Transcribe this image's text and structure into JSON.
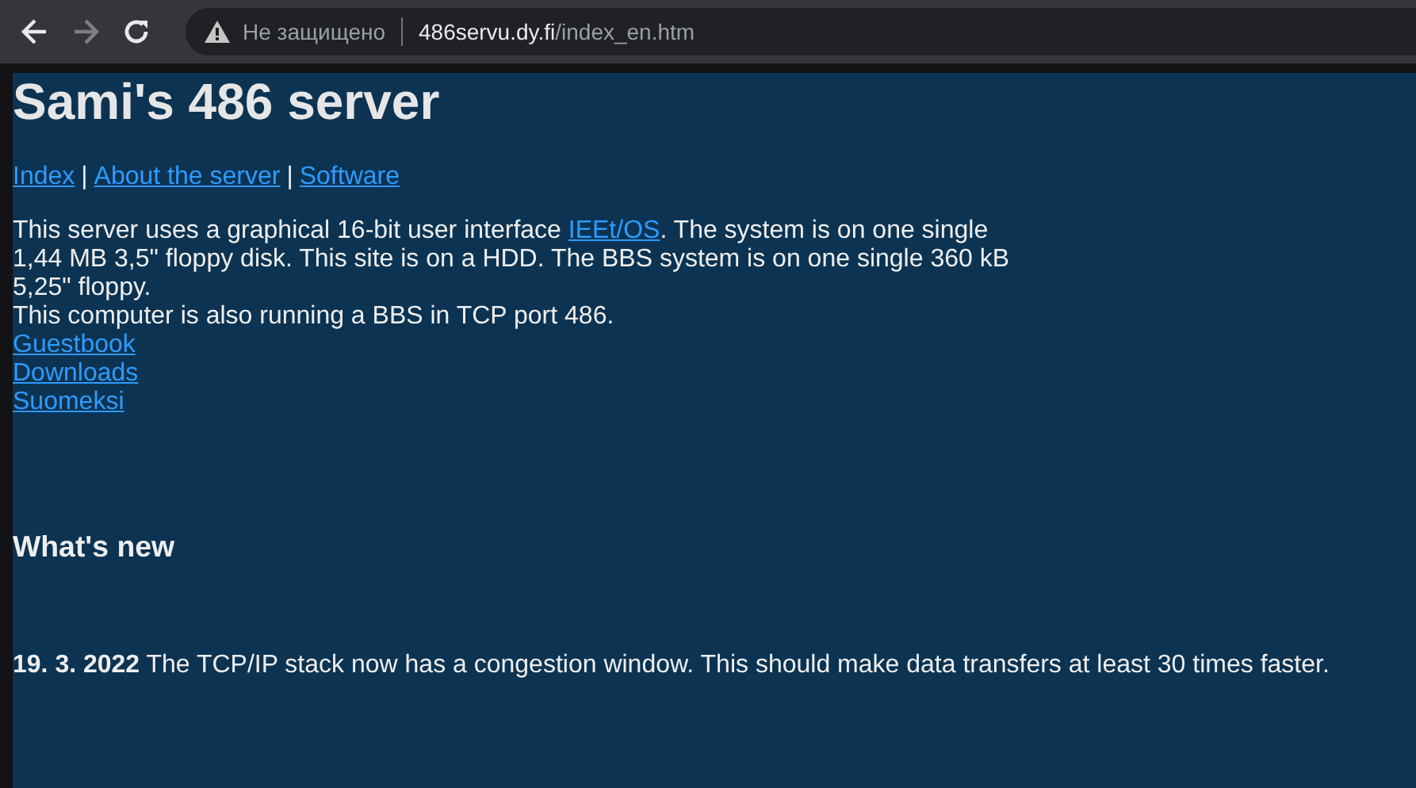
{
  "browser": {
    "back_disabled": false,
    "forward_disabled": true,
    "security": "Не защищено",
    "url_host": "486servu.dy.fi",
    "url_path": "/index_en.htm"
  },
  "page": {
    "title": "Sami's 486 server",
    "nav": [
      {
        "label": "Index",
        "separator": "|"
      },
      {
        "label": "About the server",
        "separator": "|"
      },
      {
        "label": "Software"
      }
    ],
    "intro": {
      "before": "This server uses a graphical 16-bit user interface ",
      "link": "IEEt/OS",
      "after": ". The system is on one single 1,44 MB 3,5\" floppy disk. This site is on a HDD. The BBS system is on one single 360 kB 5,25\" floppy."
    },
    "bbs_line": "This computer is also running a BBS in TCP port 486.",
    "links": [
      "Guestbook",
      "Downloads",
      "Suomeksi"
    ],
    "news_heading": "What's new",
    "news": [
      "**19. 3. 2022** The TCP/IP stack now has a congestion window. This should make data transfers at least 30 times faster."
    ]
  }
}
